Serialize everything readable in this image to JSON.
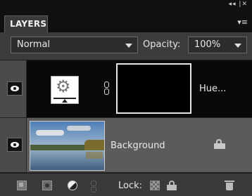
{
  "panel": {
    "tab_label": "LAYERS",
    "collapse_glyph": "◂◂ |✕",
    "menu_glyph": "▾≡"
  },
  "options": {
    "blend_mode": "Normal",
    "opacity_label": "Opacity:",
    "opacity_value": "100%"
  },
  "layers": [
    {
      "name": "Hue...",
      "type": "adjustment",
      "visible": true,
      "selected": true,
      "icon": "gear-adjustment-icon"
    },
    {
      "name": "Background",
      "type": "image",
      "visible": true,
      "selected": false,
      "locked": true
    }
  ],
  "footer": {
    "lock_label": "Lock:",
    "icons": [
      "new-layer-icon",
      "add-mask-icon",
      "adjustment-layer-icon",
      "link-layers-icon",
      "lock-transparent-pixels-icon",
      "lock-all-icon",
      "trash-icon"
    ]
  }
}
